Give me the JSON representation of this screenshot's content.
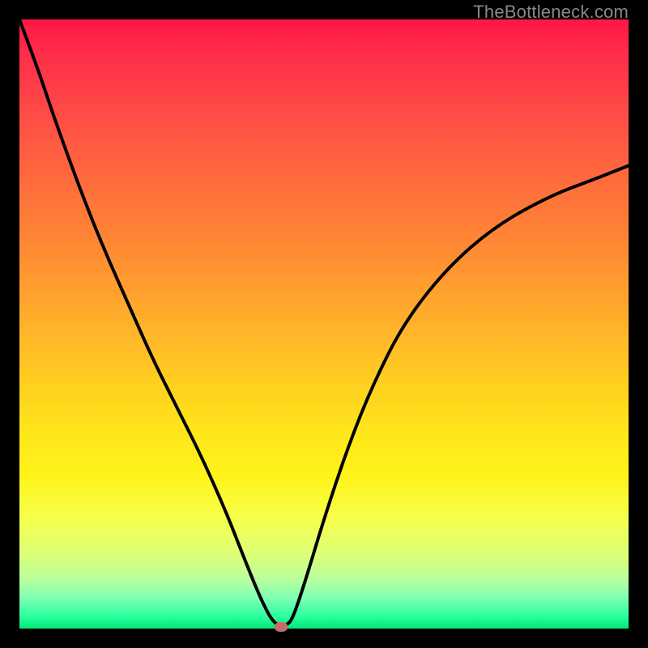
{
  "watermark": "TheBottleneck.com",
  "colors": {
    "background": "#000000",
    "curve_stroke": "#000000",
    "marker": "#c96a66",
    "gradient_top": "#ff1744",
    "gradient_bottom": "#00e676"
  },
  "chart_data": {
    "type": "line",
    "title": "",
    "xlabel": "",
    "ylabel": "",
    "xlim": [
      0,
      1
    ],
    "ylim": [
      0,
      1
    ],
    "grid": false,
    "legend": false,
    "series": [
      {
        "name": "bottleneck-curve",
        "x": [
          0.0,
          0.03,
          0.06,
          0.1,
          0.14,
          0.18,
          0.22,
          0.26,
          0.3,
          0.34,
          0.375,
          0.4,
          0.42,
          0.44,
          0.45,
          0.47,
          0.5,
          0.54,
          0.58,
          0.63,
          0.7,
          0.78,
          0.87,
          0.95,
          1.0
        ],
        "y": [
          1.0,
          0.92,
          0.83,
          0.72,
          0.62,
          0.53,
          0.44,
          0.36,
          0.28,
          0.19,
          0.1,
          0.04,
          0.005,
          0.005,
          0.02,
          0.08,
          0.18,
          0.3,
          0.4,
          0.5,
          0.59,
          0.66,
          0.71,
          0.74,
          0.76
        ]
      }
    ],
    "marker": {
      "x": 0.43,
      "y": 0.003
    },
    "gradient_stops": [
      {
        "pos": 0.0,
        "color": "#ff1744"
      },
      {
        "pos": 0.5,
        "color": "#ffb12a"
      },
      {
        "pos": 0.75,
        "color": "#fff41a"
      },
      {
        "pos": 1.0,
        "color": "#00e676"
      }
    ]
  }
}
